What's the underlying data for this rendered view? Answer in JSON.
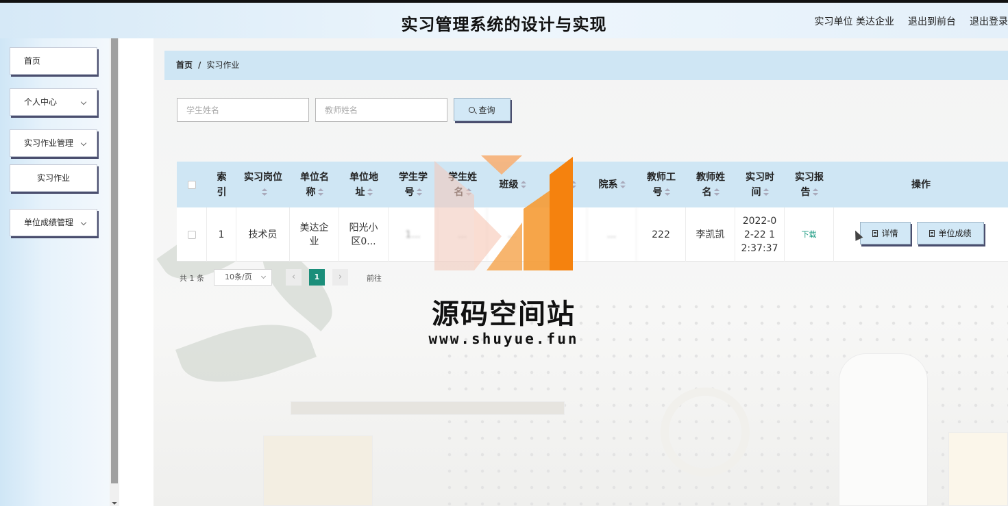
{
  "header": {
    "title": "实习管理系统的设计与实现",
    "user_info": "实习单位 美达企业",
    "back_to_front": "退出到前台",
    "logout": "退出登录"
  },
  "sidebar": {
    "items": [
      {
        "label": "首页",
        "has_arrow": false
      },
      {
        "label": "个人中心",
        "has_arrow": true
      },
      {
        "label": "实习作业管理",
        "has_arrow": true
      },
      {
        "label": "实习作业",
        "has_arrow": false
      },
      {
        "label": "单位成绩管理",
        "has_arrow": true
      }
    ]
  },
  "breadcrumb": {
    "home": "首页",
    "separator": "/",
    "current": "实习作业"
  },
  "search": {
    "student_placeholder": "学生姓名",
    "teacher_placeholder": "教师姓名",
    "button_label": "查询"
  },
  "table": {
    "headers": {
      "index": [
        "索",
        "引"
      ],
      "position": [
        "实习岗位"
      ],
      "company_name": [
        "单位名",
        "称"
      ],
      "company_addr": [
        "单位地",
        "址"
      ],
      "student_id": [
        "学生学",
        "号"
      ],
      "student_name": [
        "学生姓",
        "名"
      ],
      "class": [
        "班级"
      ],
      "major": [
        "专业"
      ],
      "department": [
        "院系"
      ],
      "teacher_id": [
        "教师工",
        "号"
      ],
      "teacher_name": [
        "教师姓",
        "名"
      ],
      "time": [
        "实习时",
        "间"
      ],
      "report": [
        "实习报",
        "告"
      ],
      "actions": [
        "操作"
      ]
    },
    "row": {
      "index": "1",
      "position": "技术员",
      "company_name": [
        "美达企",
        "业"
      ],
      "company_addr": [
        "阳光小",
        "区0..."
      ],
      "student_id": "1...",
      "student_name": "...",
      "class": "...",
      "major": "...",
      "department": "...",
      "teacher_id": "222",
      "teacher_name": "李凯凯",
      "time": [
        "2022-0",
        "2-22 1",
        "2:37:37"
      ],
      "report_link": "下载",
      "detail_button": "详情",
      "score_button": "单位成绩"
    }
  },
  "pagination": {
    "total": "共 1 条",
    "page_size": "10条/页",
    "prev_icon": "chevron-left-icon",
    "current_page": "1",
    "next_icon": "chevron-right-icon",
    "goto": "前往"
  },
  "watermark": {
    "text": "源码空间站",
    "url": "www.shuyue.fun"
  },
  "colors": {
    "header_bg": "#d6e9f7",
    "table_header_bg": "#cfe6f4",
    "button_bg": "#d2e8f6",
    "button_shadow": "#4a4e6e",
    "pager_active": "#1b8e7a",
    "watermark_orange": "#f5820e"
  }
}
